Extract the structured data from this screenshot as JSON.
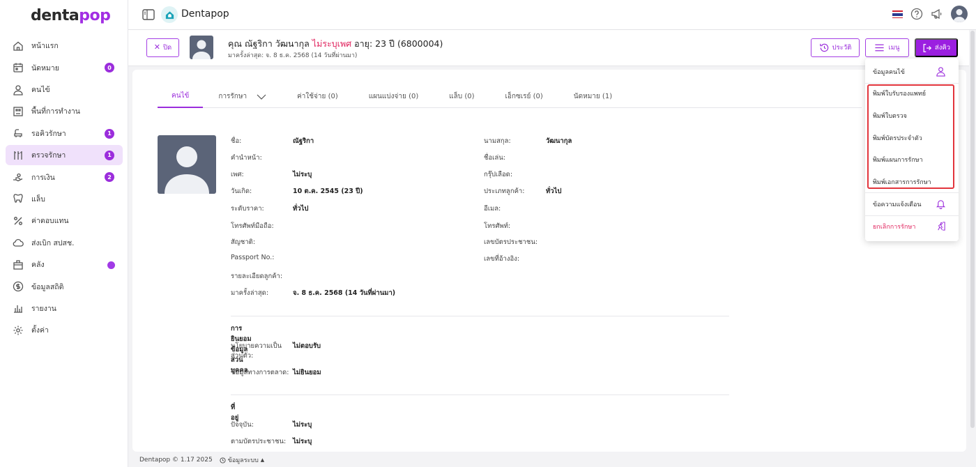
{
  "brand": {
    "logo_dark": "denta",
    "logo_accent": "pop",
    "accent_color": "#9b2ddc"
  },
  "sidebar": {
    "items": [
      {
        "label": "หน้าแรก",
        "icon": "home-icon"
      },
      {
        "label": "นัดหมาย",
        "icon": "calendar-icon",
        "badge": "0"
      },
      {
        "label": "คนไข้",
        "icon": "user-icon"
      },
      {
        "label": "พื้นที่การทำงาน",
        "icon": "workspace-icon"
      },
      {
        "label": "รอคิวรักษา",
        "icon": "dental-chair-icon",
        "badge": "1"
      },
      {
        "label": "ตรวจรักษา",
        "icon": "dental-tools-icon",
        "badge": "1"
      },
      {
        "label": "การเงิน",
        "icon": "money-icon",
        "badge": "2"
      },
      {
        "label": "แล็บ",
        "icon": "tooth-icon"
      },
      {
        "label": "ค่าตอบแทน",
        "icon": "percent-icon"
      },
      {
        "label": "ส่งเบิก สปสช.",
        "icon": "cloud-icon"
      },
      {
        "label": "คลัง",
        "icon": "box-icon"
      },
      {
        "label": "ข้อมูลสถิติ",
        "icon": "dollar-icon"
      },
      {
        "label": "รายงาน",
        "icon": "report-icon"
      },
      {
        "label": "ตั้งค่า",
        "icon": "gear-icon"
      }
    ]
  },
  "topbar": {
    "title": "Dentapop"
  },
  "patient": {
    "close_label": "ปิด",
    "name": "คุณ ณัฐริกา วัฒนากุล",
    "sex": "ไม่ระบุเพศ",
    "age_id": "อายุ: 23 ปี  (6800004)",
    "last_visit": "มาครั้งล่าสุด: จ. 8 ธ.ค. 2568 (14 วันที่ผ่านมา)",
    "history_label": "ประวัติ",
    "menu_label": "เมนู",
    "send_label": "ส่งคิว"
  },
  "tabs": [
    "คนไข้",
    "การรักษา",
    "ค่าใช้จ่าย (0)",
    "แผนแบ่งจ่าย (0)",
    "แล็บ (0)",
    "เอ็กซเรย์ (0)",
    "นัดหมาย (1)"
  ],
  "details": {
    "left": [
      {
        "label": "ชื่อ:",
        "value": "ณัฐริกา"
      },
      {
        "label": "คำนำหน้า:",
        "value": ""
      },
      {
        "label": "เพศ:",
        "value": "ไม่ระบุ"
      },
      {
        "label": "วันเกิด:",
        "value": "10 ต.ค. 2545 (23 ปี)"
      },
      {
        "label": "ระดับราคา:",
        "value": "ทั่วไป"
      },
      {
        "label": "โทรศัพท์มือถือ:",
        "value": ""
      },
      {
        "label": "สัญชาติ:",
        "value": ""
      },
      {
        "label": "Passport No.:",
        "value": ""
      },
      {
        "label": "รายละเอียดลูกค้า:",
        "value": ""
      },
      {
        "label": "มาครั้งล่าสุด:",
        "value": "จ. 8 ธ.ค. 2568 (14 วันที่ผ่านมา)"
      }
    ],
    "right": [
      {
        "label": "นามสกุล:",
        "value": "วัฒนากุล"
      },
      {
        "label": "ชื่อเล่น:",
        "value": ""
      },
      {
        "label": "กรุ๊ปเลือด:",
        "value": ""
      },
      {
        "label": "ประเภทลูกค้า:",
        "value": "ทั่วไป"
      },
      {
        "label": "อีเมล:",
        "value": ""
      },
      {
        "label": "โทรศัพท์:",
        "value": ""
      },
      {
        "label": "เลขบัตรประชาชน:",
        "value": ""
      },
      {
        "label": "เลขที่อ้างอิง:",
        "value": ""
      }
    ],
    "consent_title": "การยินยอมข้อมูลส่วนบุคคล",
    "consent": [
      {
        "label": "นโยบายความเป็น",
        "label2": "ส่วนตัว:",
        "value": "ไม่ตอบรับ"
      },
      {
        "label": "ข้อมูลทางการตลาด:",
        "value": "ไม่ยินยอม"
      }
    ],
    "address_title": "ที่อยู่",
    "address": [
      {
        "label": "ปัจจุบัน:",
        "value": "ไม่ระบุ"
      },
      {
        "label": "ตามบัตรประชาชน:",
        "value": "ไม่ระบุ"
      }
    ]
  },
  "menu_dropdown": {
    "items": [
      {
        "label": "ข้อมูลคนไข้",
        "icon": "user-icon"
      },
      {
        "label": "พิมพ์ใบรับรองแพทย์"
      },
      {
        "label": "พิมพ์ใบตรวจ"
      },
      {
        "label": "พิมพ์บัตรประจำตัว"
      },
      {
        "label": "พิมพ์แผนการรักษา"
      },
      {
        "label": "พิมพ์เอกสารการรักษา"
      },
      {
        "label": "ข้อความแจ้งเตือน",
        "icon": "bell-icon"
      },
      {
        "label": "ยกเลิกการรักษา",
        "icon": "exit-icon",
        "color": "#e0245e"
      }
    ]
  },
  "footer": {
    "copyright": "Dentapop © 1.17 2025",
    "system_info": "ข้อมูลระบบ"
  }
}
